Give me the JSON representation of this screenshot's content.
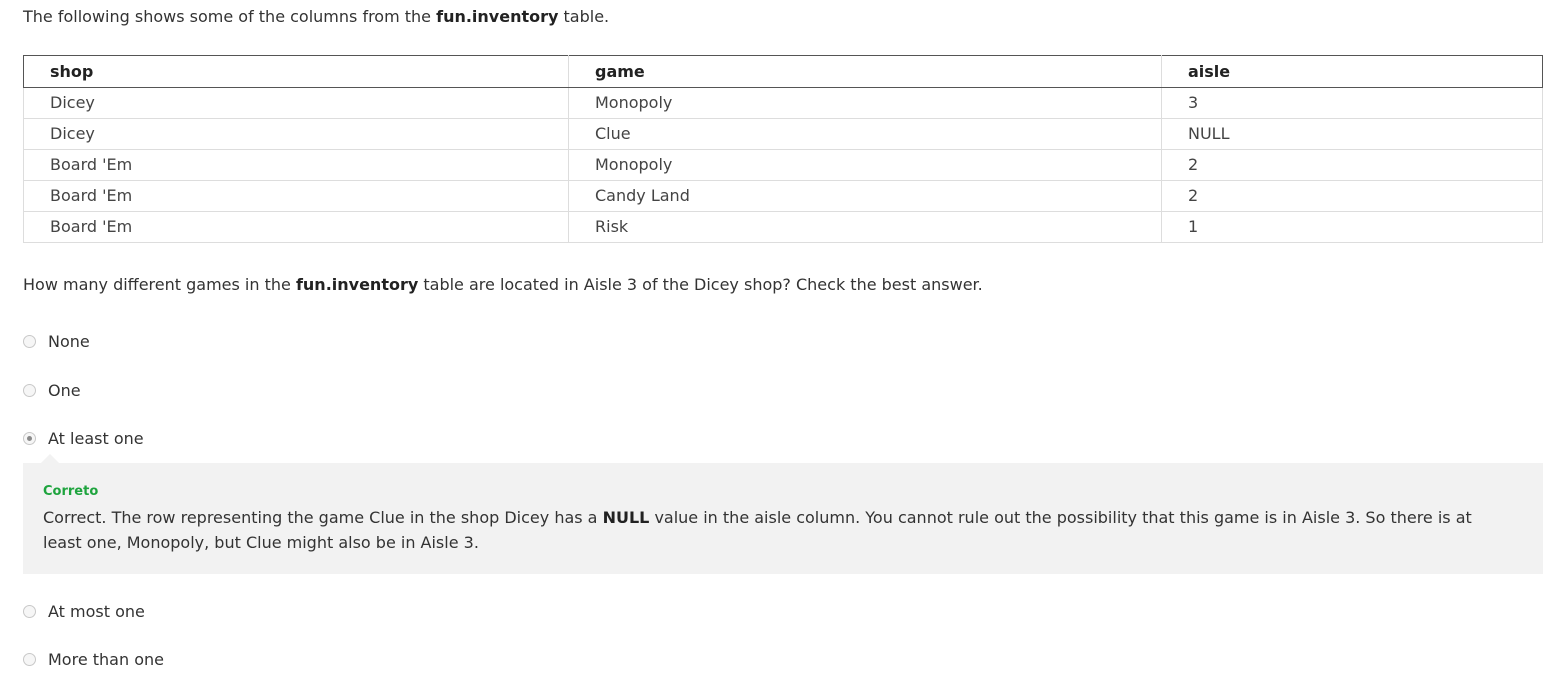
{
  "intro": {
    "prefix": "The following shows some of the columns from the ",
    "table_name": "fun.inventory",
    "suffix": " table."
  },
  "table": {
    "headers": [
      "shop",
      "game",
      "aisle"
    ],
    "rows": [
      [
        "Dicey",
        "Monopoly",
        "3"
      ],
      [
        "Dicey",
        "Clue",
        "NULL"
      ],
      [
        "Board 'Em",
        "Monopoly",
        "2"
      ],
      [
        "Board 'Em",
        "Candy Land",
        "2"
      ],
      [
        "Board 'Em",
        "Risk",
        "1"
      ]
    ]
  },
  "question": {
    "prefix": "How many different games in the ",
    "table_name": "fun.inventory",
    "suffix": " table are located in Aisle 3 of the Dicey shop? Check the best answer."
  },
  "options": [
    {
      "label": "None",
      "selected": false
    },
    {
      "label": "One",
      "selected": false
    },
    {
      "label": "At least one",
      "selected": true
    },
    {
      "label": "At most one",
      "selected": false
    },
    {
      "label": "More than one",
      "selected": false
    }
  ],
  "feedback": {
    "status": "Correto",
    "status_color": "#1ea43e",
    "text_before": "Correct. The row representing the game Clue in the shop Dicey has a ",
    "bold": "NULL",
    "text_after": " value in the aisle column. You cannot rule out the possibility that this game is in Aisle 3. So there is at least one, Monopoly, but Clue might also be in Aisle 3."
  }
}
